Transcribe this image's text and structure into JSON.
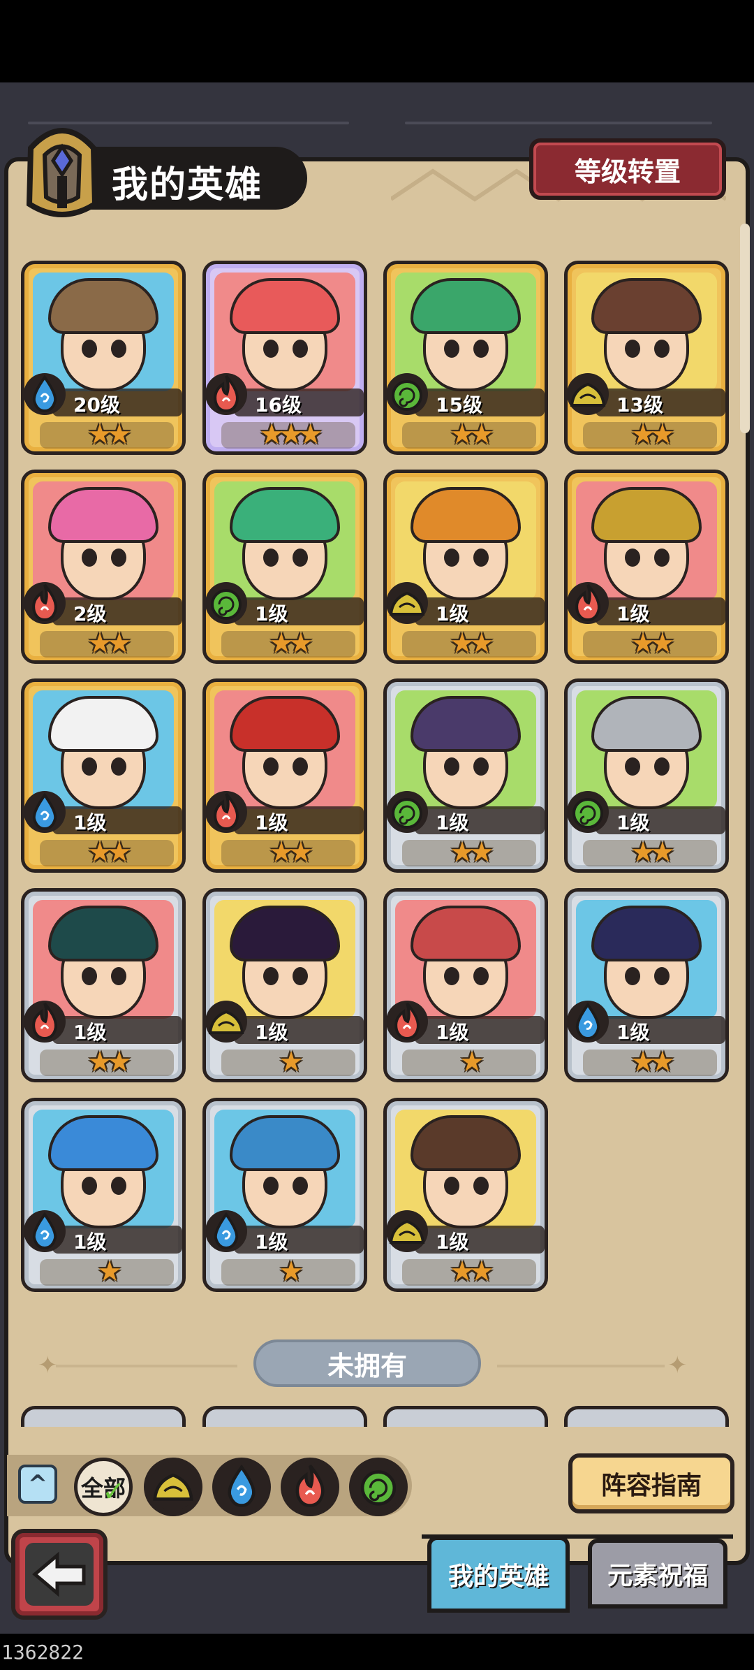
{
  "header": {
    "title": "我的英雄",
    "level_transfer_label": "等级转置"
  },
  "heroes": [
    {
      "level": "20级",
      "stars": "★★",
      "element": "water",
      "rarity": "gold",
      "bg": "blue",
      "hair": "#8a6a48"
    },
    {
      "level": "16级",
      "stars": "★★★",
      "element": "fire",
      "rarity": "purple",
      "bg": "pink",
      "hair": "#e85a5a"
    },
    {
      "level": "15级",
      "stars": "★★",
      "element": "wind",
      "rarity": "gold",
      "bg": "green",
      "hair": "#3aa66a"
    },
    {
      "level": "13级",
      "stars": "★★",
      "element": "earth",
      "rarity": "gold",
      "bg": "yellow",
      "hair": "#6a4030"
    },
    {
      "level": "2级",
      "stars": "★★",
      "element": "fire",
      "rarity": "gold",
      "bg": "pink",
      "hair": "#e86aa6"
    },
    {
      "level": "1级",
      "stars": "★★",
      "element": "wind",
      "rarity": "gold",
      "bg": "green",
      "hair": "#3ab07a"
    },
    {
      "level": "1级",
      "stars": "★★",
      "element": "earth",
      "rarity": "gold",
      "bg": "yellow",
      "hair": "#e08a2a"
    },
    {
      "level": "1级",
      "stars": "★★",
      "element": "fire",
      "rarity": "gold",
      "bg": "pink",
      "hair": "#c8a030"
    },
    {
      "level": "1级",
      "stars": "★★",
      "element": "water",
      "rarity": "gold",
      "bg": "blue",
      "hair": "#f2f2f2"
    },
    {
      "level": "1级",
      "stars": "★★",
      "element": "fire",
      "rarity": "gold",
      "bg": "pink",
      "hair": "#c8302a"
    },
    {
      "level": "1级",
      "stars": "★★",
      "element": "wind",
      "rarity": "silver",
      "bg": "green",
      "hair": "#4a3a6a"
    },
    {
      "level": "1级",
      "stars": "★★",
      "element": "wind",
      "rarity": "silver",
      "bg": "green",
      "hair": "#b0b4ba"
    },
    {
      "level": "1级",
      "stars": "★★",
      "element": "fire",
      "rarity": "silver",
      "bg": "pink",
      "hair": "#1e4a4a"
    },
    {
      "level": "1级",
      "stars": "★",
      "element": "earth",
      "rarity": "silver",
      "bg": "yellow",
      "hair": "#2a1a3a"
    },
    {
      "level": "1级",
      "stars": "★",
      "element": "fire",
      "rarity": "silver",
      "bg": "pink",
      "hair": "#c84a4a"
    },
    {
      "level": "1级",
      "stars": "★★",
      "element": "water",
      "rarity": "silver",
      "bg": "blue",
      "hair": "#2a2a5a"
    },
    {
      "level": "1级",
      "stars": "★",
      "element": "water",
      "rarity": "silver",
      "bg": "blue",
      "hair": "#3a8ad8"
    },
    {
      "level": "1级",
      "stars": "★",
      "element": "water",
      "rarity": "silver",
      "bg": "blue",
      "hair": "#3a8ac8"
    },
    {
      "level": "1级",
      "stars": "★★",
      "element": "earth",
      "rarity": "silver",
      "bg": "yellow",
      "hair": "#5a3a2a"
    }
  ],
  "not_owned_label": "未拥有",
  "filters": {
    "all_label": "全部",
    "elements": [
      "earth",
      "water",
      "fire",
      "wind"
    ]
  },
  "lineup_guide_label": "阵容指南",
  "tabs": {
    "my_heroes": "我的英雄",
    "element_blessing": "元素祝福"
  },
  "footer_code": "1362822 03525a",
  "colors": {
    "water": "#3a9ae0",
    "fire": "#e85a50",
    "wind": "#5ab83a",
    "earth": "#d8c03a",
    "panel": "#d8c49e"
  }
}
